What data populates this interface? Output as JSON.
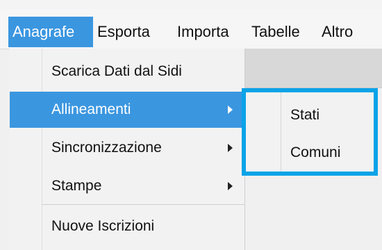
{
  "menubar": {
    "items": [
      {
        "label": "Anagrafe"
      },
      {
        "label": "Esporta"
      },
      {
        "label": "Importa"
      },
      {
        "label": "Tabelle"
      },
      {
        "label": "Altro"
      }
    ]
  },
  "dropdown": {
    "items": [
      {
        "label": "Scarica Dati dal Sidi"
      },
      {
        "label": "Allineamenti",
        "has_submenu": true
      },
      {
        "label": "Sincronizzazione",
        "has_submenu": true
      },
      {
        "label": "Stampe",
        "has_submenu": true
      },
      {
        "label": "Nuove Iscrizioni"
      }
    ]
  },
  "submenu": {
    "items": [
      {
        "label": "Stati"
      },
      {
        "label": "Comuni"
      }
    ]
  },
  "colors": {
    "highlight": "#3b96e0",
    "submenu_border": "#0aa3e8",
    "menu_bg": "#f2f2f2"
  }
}
